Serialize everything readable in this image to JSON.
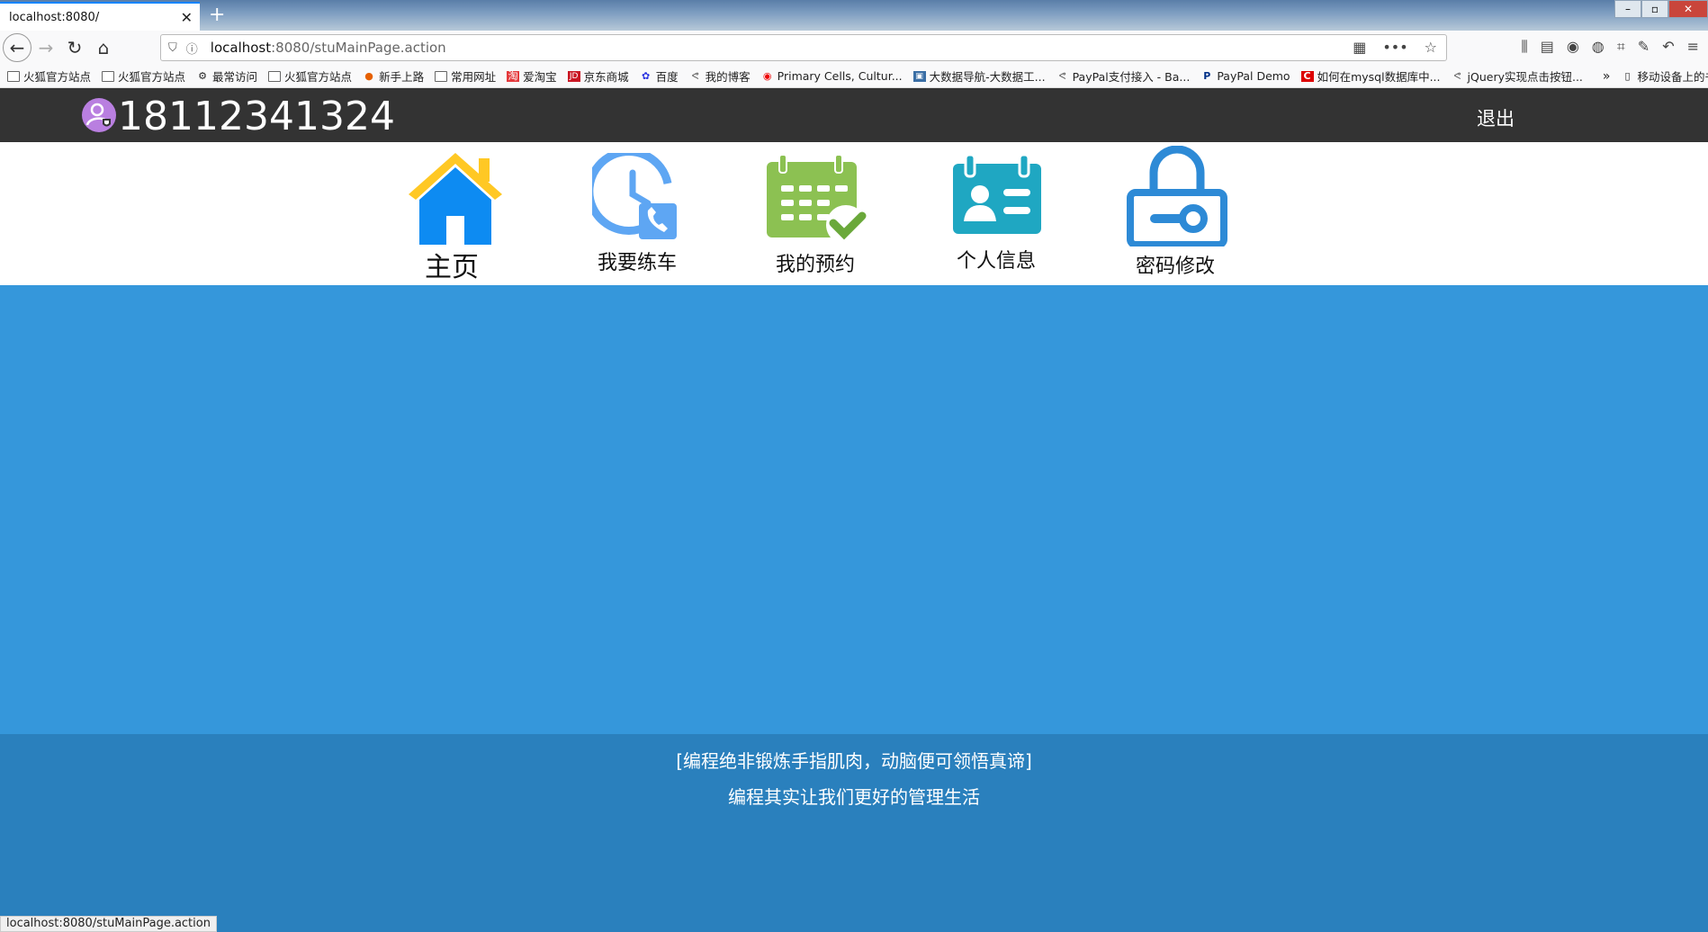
{
  "browser": {
    "tab_title": "localhost:8080/",
    "url_host": "localhost",
    "url_rest": ":8080/stuMainPage.action",
    "status_url": "localhost:8080/stuMainPage.action",
    "bookmarks": [
      {
        "label": "火狐官方站点"
      },
      {
        "label": "火狐官方站点"
      },
      {
        "label": "最常访问"
      },
      {
        "label": "火狐官方站点"
      },
      {
        "label": "新手上路"
      },
      {
        "label": "常用网址"
      },
      {
        "label": "爱淘宝"
      },
      {
        "label": "京东商城"
      },
      {
        "label": "百度"
      },
      {
        "label": "我的博客"
      },
      {
        "label": "Primary Cells, Cultur..."
      },
      {
        "label": "大数据导航-大数据工..."
      },
      {
        "label": "PayPal支付接入 - Ba..."
      },
      {
        "label": "PayPal Demo"
      },
      {
        "label": "如何在mysql数据库中..."
      },
      {
        "label": "jQuery实现点击按钮..."
      },
      {
        "label": "移动设备上的书"
      }
    ]
  },
  "header": {
    "user_phone": "18112341324",
    "logout_label": "退出"
  },
  "menu": {
    "home": "主页",
    "practice": "我要练车",
    "appointments": "我的预约",
    "profile": "个人信息",
    "password": "密码修改"
  },
  "footer": {
    "line1": "[编程绝非锻炼手指肌肉，动脑便可领悟真谛]",
    "line2": "编程其实让我们更好的管理生活"
  },
  "colors": {
    "header_bg": "#333333",
    "content_bg": "#3597db",
    "footer_bg": "#2a80bd"
  }
}
